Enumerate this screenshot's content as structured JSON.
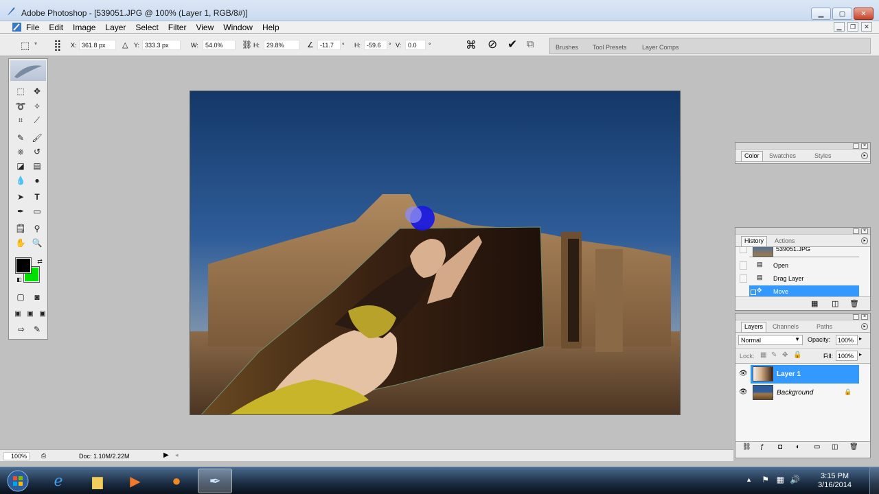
{
  "window": {
    "title": "Adobe Photoshop - [539051.JPG @ 100% (Layer 1, RGB/8#)]",
    "minimize_icon": "minimize-icon",
    "maximize_icon": "maximize-icon",
    "close_icon": "close-icon"
  },
  "menu": [
    "File",
    "Edit",
    "Image",
    "Layer",
    "Select",
    "Filter",
    "View",
    "Window",
    "Help"
  ],
  "options": {
    "x_label": "X:",
    "x_value": "361.8 px",
    "y_label": "Y:",
    "y_value": "333.3 px",
    "w_label": "W:",
    "w_value": "54.0%",
    "h_label": "H:",
    "h_value": "29.8%",
    "angle_value": "-11.7",
    "deg": "°",
    "hskew_label": "H:",
    "hskew_value": "-59.6",
    "vskew_label": "V:",
    "vskew_value": "0.0"
  },
  "palette_well": [
    "Brushes",
    "Tool Presets",
    "Layer Comps"
  ],
  "color_panel": {
    "tabs": [
      "Color",
      "Swatches",
      "Styles"
    ]
  },
  "history_panel": {
    "tabs": [
      "History",
      "Actions"
    ],
    "snapshot": "539051.JPG",
    "items": [
      {
        "label": "Open",
        "selected": false
      },
      {
        "label": "Drag Layer",
        "selected": false
      },
      {
        "label": "Move",
        "selected": true
      }
    ]
  },
  "layers_panel": {
    "tabs": [
      "Layers",
      "Channels",
      "Paths"
    ],
    "blend_mode": "Normal",
    "opacity_label": "Opacity:",
    "opacity": "100%",
    "lock_label": "Lock:",
    "fill_label": "Fill:",
    "fill": "100%",
    "layers": [
      {
        "name": "Layer 1",
        "selected": true
      },
      {
        "name": "Background",
        "selected": false,
        "locked": true
      }
    ]
  },
  "status": {
    "zoom": "100%",
    "doc": "Doc: 1.10M/2.22M"
  },
  "taskbar": {
    "time": "3:15 PM",
    "date": "3/16/2014"
  },
  "colors": {
    "foreground": "#000000",
    "background": "#00e000",
    "selection": "#3399ff"
  }
}
